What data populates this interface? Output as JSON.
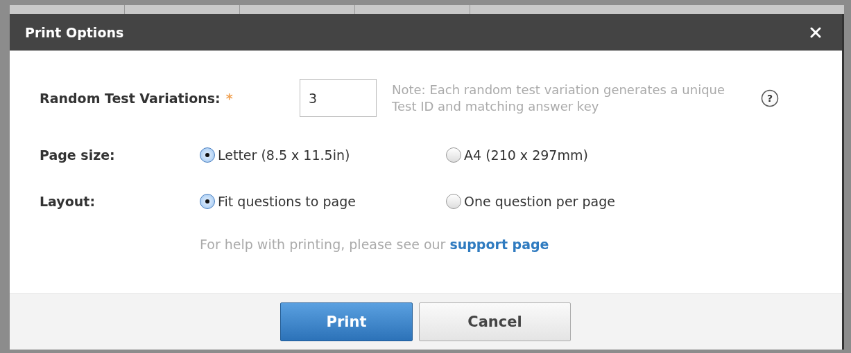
{
  "window": {
    "title": "Print Options"
  },
  "variations": {
    "label": "Random Test Variations:",
    "required_mark": "*",
    "value": "3",
    "note": "Note: Each random test variation generates a unique Test ID and matching answer key",
    "help_icon": "?"
  },
  "page_size": {
    "label": "Page size:",
    "options": [
      {
        "label": "Letter (8.5 x 11.5in)",
        "selected": true
      },
      {
        "label": "A4 (210 x 297mm)",
        "selected": false
      }
    ]
  },
  "layout": {
    "label": "Layout:",
    "options": [
      {
        "label": "Fit questions to page",
        "selected": true
      },
      {
        "label": "One question per page",
        "selected": false
      }
    ]
  },
  "help": {
    "text": "For help with printing, please see our",
    "link": "support page"
  },
  "buttons": [
    {
      "label": "Print",
      "kind": "primary"
    },
    {
      "label": "Cancel",
      "kind": "secondary"
    }
  ]
}
